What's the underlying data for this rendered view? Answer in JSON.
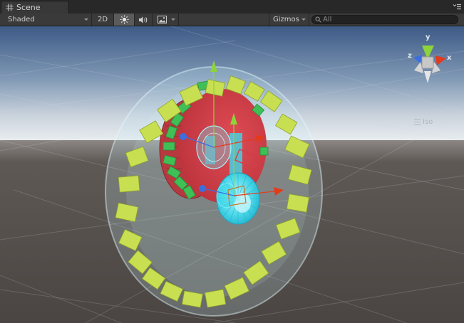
{
  "tab": {
    "title": "Scene",
    "icon": "grid-icon"
  },
  "toolbar": {
    "shading_mode": "Shaded",
    "mode_2d": "2D",
    "lighting_icon": "sun-icon",
    "audio_icon": "speaker-icon",
    "effects_icon": "image-icon",
    "gizmos_label": "Gizmos",
    "search_placeholder": "All"
  },
  "orientation_gizmo": {
    "axis_y": "y",
    "axis_x": "x",
    "axis_z": "z",
    "projection": "Iso"
  },
  "colors": {
    "sky_top": "#3e5a86",
    "horizon": "#e8ecef",
    "ground": "#5c5652",
    "red_disc": "#d53c44",
    "green_tiles": "#3fbf55",
    "yellow_cubes": "#c9df52",
    "cyan_gear": "#3fd8ea",
    "x_axis": "#e23b1c",
    "y_axis": "#8dd43a",
    "z_axis": "#3b6fe0"
  }
}
